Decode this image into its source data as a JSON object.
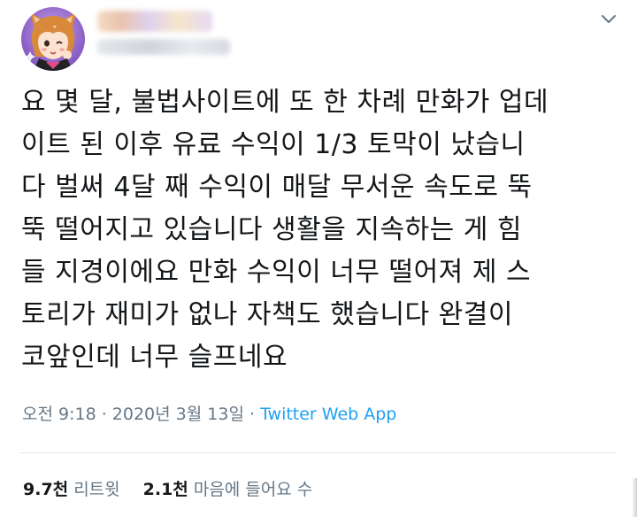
{
  "author": {
    "avatar_icon": "cartoon-avatar-icon",
    "name": "",
    "handle": ""
  },
  "menu": {
    "icon": "chevron-down-icon"
  },
  "tweet": {
    "text": "요 몇 달, 불법사이트에 또 한 차례 만화가 업데\n이트 된 이후 유료 수익이 1/3 토막이 났습니\n다 벌써 4달 째 수익이 매달 무서운 속도로 뚝\n뚝 떨어지고 있습니다 생활을 지속하는 게 힘\n들 지경이에요 만화 수익이 너무 떨어져 제 스\n토리가 재미가 없나 자책도 했습니다 완결이\n코앞인데 너무 슬프네요"
  },
  "meta": {
    "time": "오전 9:18",
    "separator_1": " · ",
    "date": "2020년 3월 13일",
    "separator_2": " · ",
    "source": "Twitter Web App"
  },
  "stats": {
    "retweets_count": "9.7천",
    "retweets_label": "리트윗",
    "likes_count": "2.1천",
    "likes_label": "마음에 들어요 수"
  },
  "colors": {
    "text": "#14171a",
    "secondary": "#657786",
    "link": "#1da1f2",
    "divider": "#e1e8ed"
  }
}
